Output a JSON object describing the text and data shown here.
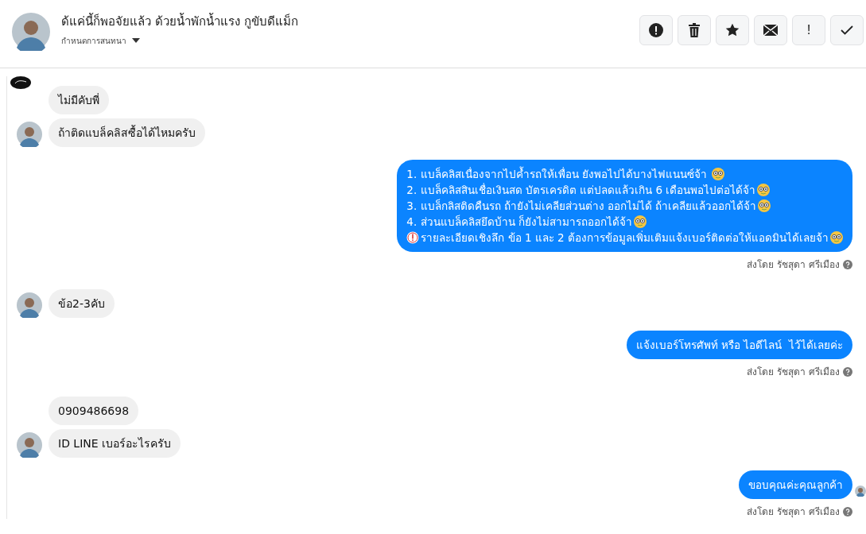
{
  "header": {
    "title": "ด้แค่นี้ก็พอจัยแล้ว ด้วยน้ำพักน้ำแรง กูขับดีแม็ก",
    "subtitle": "กำหนดการสนทนา",
    "actions": [
      {
        "kind": "alert"
      },
      {
        "kind": "trash"
      },
      {
        "kind": "star"
      },
      {
        "kind": "mail"
      },
      {
        "kind": "exclaim",
        "label": "!"
      },
      {
        "kind": "check"
      }
    ]
  },
  "messages": [
    {
      "kind": "marker"
    },
    {
      "kind": "incoming",
      "avatar": false,
      "lines": [
        {
          "text": "ไม่มีคับพี่"
        }
      ]
    },
    {
      "kind": "incoming",
      "avatar": true,
      "lines": [
        {
          "text": "ถ้าติดแบล็คลิสซื้อได้ไหมครับ"
        }
      ]
    },
    {
      "kind": "outgoing",
      "seen_avatar": false,
      "sent_by": "ส่งโดย รัชสุดา ศรีเมือง",
      "lines": [
        {
          "text": "1. แบล็คลิสเนื่องจากไปค้ำรถให้เพื่อน ยังพอไปได้บางไฟแนนซ์จ้า ",
          "emoji": true,
          "lead_icon": false
        },
        {
          "text": "2. แบล็คลิสสินเชื่อเงินสด บัตรเครดิต แต่ปลดแล้วเกิน 6 เดือนพอไปต่อได้จ้า",
          "emoji": true,
          "lead_icon": false
        },
        {
          "text": "3. แบล็กลิสติดคืนรถ ถ้ายังไม่เคลียส่วนต่าง ออกไม่ได้ ถ้าเคลียแล้วออกได้จ้า",
          "emoji": true,
          "lead_icon": false
        },
        {
          "text": "4. ส่วนแบล็คลิสยึดบ้าน ก็ยังไม่สามารถออกได้จ้า",
          "emoji": true,
          "lead_icon": false
        },
        {
          "text": "รายละเอียดเชิงลึก ข้อ 1 และ 2 ต้องการข้อมูลเพิ่มเติมแจ้งเบอร์ติดต่อให้แอดมินได้เลยจ้า",
          "emoji": true,
          "lead_icon": true
        }
      ]
    },
    {
      "kind": "incoming",
      "avatar": true,
      "lines": [
        {
          "text": "ข้อ2-3คับ"
        }
      ]
    },
    {
      "kind": "outgoing",
      "seen_avatar": false,
      "sent_by": "ส่งโดย รัชสุดา ศรีเมือง",
      "lines": [
        {
          "text": "แจ้งเบอร์โทรศัพท์ หรือ ไอดีไลน์  ไว้ได้เลยค่ะ",
          "emoji": false,
          "lead_icon": false
        }
      ]
    },
    {
      "kind": "incoming",
      "avatar": false,
      "lines": [
        {
          "text": "0909486698"
        }
      ]
    },
    {
      "kind": "incoming",
      "avatar": true,
      "lines": [
        {
          "text": "ID LINE เบอร์อะไรครับ"
        }
      ]
    },
    {
      "kind": "outgoing",
      "seen_avatar": true,
      "sent_by": "ส่งโดย รัชสุดา ศรีเมือง",
      "lines": [
        {
          "text": "ขอบคุณค่ะคุณลูกค้า",
          "emoji": false,
          "lead_icon": false
        }
      ]
    }
  ]
}
